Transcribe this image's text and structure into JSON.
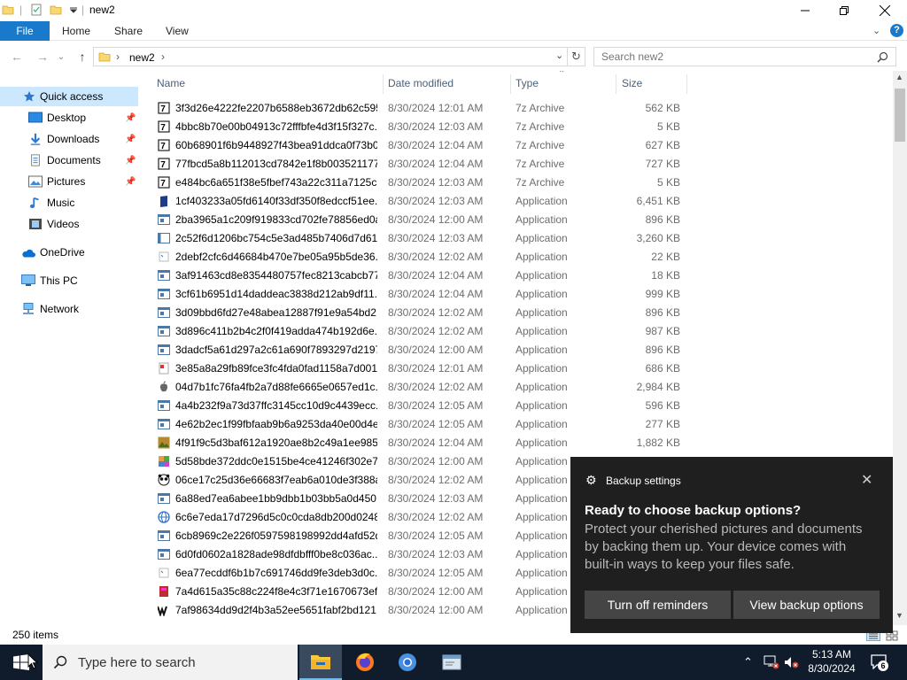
{
  "window": {
    "title": "new2"
  },
  "ribbon": {
    "tabs": [
      "File",
      "Home",
      "Share",
      "View"
    ]
  },
  "address": {
    "path_segment": "new2",
    "search_placeholder": "Search new2"
  },
  "nav": {
    "items": [
      {
        "label": "Quick access",
        "icon": "star-icon",
        "pinned": false,
        "selected": true
      },
      {
        "label": "Desktop",
        "icon": "desktop-icon",
        "pinned": true
      },
      {
        "label": "Downloads",
        "icon": "download-icon",
        "pinned": true
      },
      {
        "label": "Documents",
        "icon": "document-icon",
        "pinned": true
      },
      {
        "label": "Pictures",
        "icon": "picture-icon",
        "pinned": true
      },
      {
        "label": "Music",
        "icon": "music-icon",
        "pinned": false
      },
      {
        "label": "Videos",
        "icon": "video-icon",
        "pinned": false
      },
      {
        "label": "OneDrive",
        "icon": "cloud-icon",
        "pinned": false
      },
      {
        "label": "This PC",
        "icon": "computer-icon",
        "pinned": false
      },
      {
        "label": "Network",
        "icon": "network-icon",
        "pinned": false
      }
    ]
  },
  "columns": {
    "name": "Name",
    "date": "Date modified",
    "type": "Type",
    "size": "Size"
  },
  "files": [
    {
      "name": "3f3d26e4222fe2207b6588eb3672db62c595...",
      "date": "8/30/2024 12:01 AM",
      "type": "7z Archive",
      "size": "562 KB",
      "icon": "7z"
    },
    {
      "name": "4bbc8b70e00b04913c72fffbfe4d3f15f327c...",
      "date": "8/30/2024 12:03 AM",
      "type": "7z Archive",
      "size": "5 KB",
      "icon": "7z"
    },
    {
      "name": "60b68901f6b9448927f43bea91ddca0f73b0...",
      "date": "8/30/2024 12:04 AM",
      "type": "7z Archive",
      "size": "627 KB",
      "icon": "7z"
    },
    {
      "name": "77fbcd5a8b112013cd7842e1f8b003521177...",
      "date": "8/30/2024 12:04 AM",
      "type": "7z Archive",
      "size": "727 KB",
      "icon": "7z"
    },
    {
      "name": "e484bc6a651f38e5fbef743a22c311a7125c...",
      "date": "8/30/2024 12:03 AM",
      "type": "7z Archive",
      "size": "5 KB",
      "icon": "7z"
    },
    {
      "name": "1cf403233a05fd6140f33df350f8edccf51ee...",
      "date": "8/30/2024 12:03 AM",
      "type": "Application",
      "size": "6,451 KB",
      "icon": "dark"
    },
    {
      "name": "2ba3965a1c209f919833cd702fe78856ed0a...",
      "date": "8/30/2024 12:00 AM",
      "type": "Application",
      "size": "896 KB",
      "icon": "app"
    },
    {
      "name": "2c52f6d1206bc754c5e3ad485b7406d7d61...",
      "date": "8/30/2024 12:03 AM",
      "type": "Application",
      "size": "3,260 KB",
      "icon": "plain"
    },
    {
      "name": "2debf2cfc6d46684b470e7be05a95b5de36...",
      "date": "8/30/2024 12:02 AM",
      "type": "Application",
      "size": "22 KB",
      "icon": "generic"
    },
    {
      "name": "3af91463cd8e8354480757fec8213cabcb77...",
      "date": "8/30/2024 12:04 AM",
      "type": "Application",
      "size": "18 KB",
      "icon": "app"
    },
    {
      "name": "3cf61b6951d14daddeac3838d212ab9df11...",
      "date": "8/30/2024 12:04 AM",
      "type": "Application",
      "size": "999 KB",
      "icon": "app"
    },
    {
      "name": "3d09bbd6fd27e48abea12887f91e9a54bd2...",
      "date": "8/30/2024 12:02 AM",
      "type": "Application",
      "size": "896 KB",
      "icon": "app"
    },
    {
      "name": "3d896c411b2b4c2f0f419adda474b192d6e...",
      "date": "8/30/2024 12:02 AM",
      "type": "Application",
      "size": "987 KB",
      "icon": "app"
    },
    {
      "name": "3dadcf5a61d297a2c61a690f7893297d2197...",
      "date": "8/30/2024 12:00 AM",
      "type": "Application",
      "size": "896 KB",
      "icon": "app"
    },
    {
      "name": "3e85a8a29fb89fce3fc4fda0fad1158a7d001...",
      "date": "8/30/2024 12:01 AM",
      "type": "Application",
      "size": "686 KB",
      "icon": "red"
    },
    {
      "name": "04d7b1fc76fa4fb2a7d88fe6665e0657ed1c...",
      "date": "8/30/2024 12:02 AM",
      "type": "Application",
      "size": "2,984 KB",
      "icon": "apple"
    },
    {
      "name": "4a4b232f9a73d37ffc3145cc10d9c4439ecc...",
      "date": "8/30/2024 12:05 AM",
      "type": "Application",
      "size": "596 KB",
      "icon": "app"
    },
    {
      "name": "4e62b2ec1f99fbfaab9b6a9253da40e00d4e...",
      "date": "8/30/2024 12:05 AM",
      "type": "Application",
      "size": "277 KB",
      "icon": "app"
    },
    {
      "name": "4f91f9c5d3baf612a1920ae8b2c49a1ee985...",
      "date": "8/30/2024 12:04 AM",
      "type": "Application",
      "size": "1,882 KB",
      "icon": "photo"
    },
    {
      "name": "5d58bde372ddc0e1515be4ce41246f302e7...",
      "date": "8/30/2024 12:00 AM",
      "type": "Application",
      "size": "",
      "icon": "colorful"
    },
    {
      "name": "06ce17c25d36e66683f7eab6a010de3f388a...",
      "date": "8/30/2024 12:02 AM",
      "type": "Application",
      "size": "",
      "icon": "panda"
    },
    {
      "name": "6a88ed7ea6abee1bb9dbb1b03bb5a0d450...",
      "date": "8/30/2024 12:03 AM",
      "type": "Application",
      "size": "",
      "icon": "app"
    },
    {
      "name": "6c6e7eda17d7296d5c0c0cda8db200d0248...",
      "date": "8/30/2024 12:02 AM",
      "type": "Application",
      "size": "",
      "icon": "globe"
    },
    {
      "name": "6cb8969c2e226f0597598198992dd4afd52d...",
      "date": "8/30/2024 12:05 AM",
      "type": "Application",
      "size": "",
      "icon": "app"
    },
    {
      "name": "6d0fd0602a1828ade98dfdbfff0be8c036ac...",
      "date": "8/30/2024 12:03 AM",
      "type": "Application",
      "size": "",
      "icon": "app"
    },
    {
      "name": "6ea77ecddf6b1b7c691746dd9fe3deb3d0c...",
      "date": "8/30/2024 12:05 AM",
      "type": "Application",
      "size": "",
      "icon": "generic"
    },
    {
      "name": "7a4d615a35c88c224f8e4c3f71e1670673ef4...",
      "date": "8/30/2024 12:00 AM",
      "type": "Application",
      "size": "",
      "icon": "redbox"
    },
    {
      "name": "7af98634dd9d2f4b3a52ee5651fabf2bd121...",
      "date": "8/30/2024 12:00 AM",
      "type": "Application",
      "size": "",
      "icon": "w"
    }
  ],
  "status": {
    "item_count": "250 items"
  },
  "toast": {
    "app_name": "Backup settings",
    "title": "Ready to choose backup options?",
    "body": "Protect your cherished pictures and documents by backing them up. Your device comes with built-in ways to keep your files safe.",
    "button_secondary": "Turn off reminders",
    "button_primary": "View backup options"
  },
  "taskbar": {
    "search_placeholder": "Type here to search",
    "time": "5:13 AM",
    "date": "8/30/2024",
    "notification_count": "6"
  },
  "colors": {
    "file_tab": "#1979ca",
    "selection": "#cce8ff",
    "taskbar": "#101c2c",
    "toast_bg": "#1f1f1f",
    "toast_button": "#454545"
  }
}
